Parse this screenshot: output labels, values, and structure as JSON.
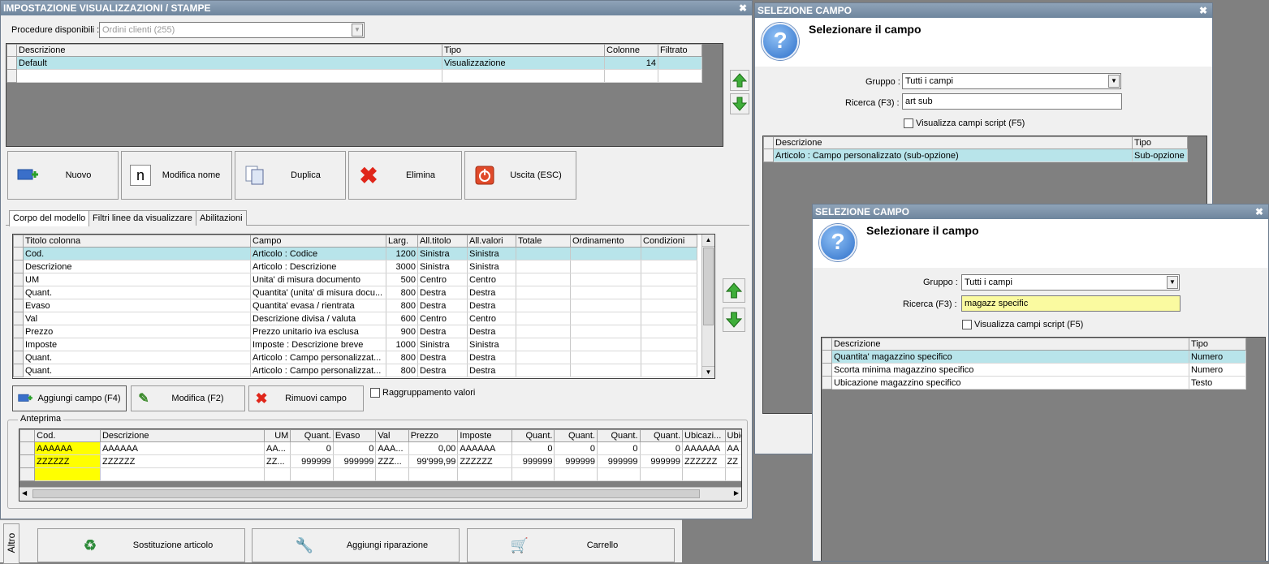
{
  "main_window": {
    "title": "IMPOSTAZIONE VISUALIZZAZIONI / STAMPE",
    "procedure_label": "Procedure disponibili :",
    "procedure_value": "Ordini clienti (255)",
    "models_table": {
      "headers": [
        "Descrizione",
        "Tipo",
        "Colonne",
        "Filtrato"
      ],
      "rows": [
        {
          "descrizione": "Default",
          "tipo": "Visualizzazione",
          "colonne": "14",
          "filtrato": ""
        }
      ]
    },
    "buttons": {
      "nuovo": "Nuovo",
      "modifica_nome": "Modifica nome",
      "duplica": "Duplica",
      "elimina": "Elimina",
      "uscita": "Uscita (ESC)"
    },
    "tabs": [
      "Corpo del modello",
      "Filtri linee da visualizzare",
      "Abilitazioni"
    ],
    "columns_table": {
      "headers": [
        "Titolo colonna",
        "Campo",
        "Larg.",
        "All.titolo",
        "All.valori",
        "Totale",
        "Ordinamento",
        "Condizioni"
      ],
      "rows": [
        [
          "Cod.",
          "Articolo : Codice",
          "1200",
          "Sinistra",
          "Sinistra",
          "",
          "",
          ""
        ],
        [
          "Descrizione",
          "Articolo : Descrizione",
          "3000",
          "Sinistra",
          "Sinistra",
          "",
          "",
          ""
        ],
        [
          "UM",
          "Unita' di misura documento",
          "500",
          "Centro",
          "Centro",
          "",
          "",
          ""
        ],
        [
          "Quant.",
          "Quantita' (unita' di misura docu...",
          "800",
          "Destra",
          "Destra",
          "",
          "",
          ""
        ],
        [
          "Evaso",
          "Quantita' evasa / rientrata",
          "800",
          "Destra",
          "Destra",
          "",
          "",
          ""
        ],
        [
          "Val",
          "Descrizione divisa / valuta",
          "600",
          "Centro",
          "Centro",
          "",
          "",
          ""
        ],
        [
          "Prezzo",
          "Prezzo unitario iva esclusa",
          "900",
          "Destra",
          "Destra",
          "",
          "",
          ""
        ],
        [
          "Imposte",
          "Imposte : Descrizione breve",
          "1000",
          "Sinistra",
          "Sinistra",
          "",
          "",
          ""
        ],
        [
          "Quant.",
          "Articolo : Campo personalizzat...",
          "800",
          "Destra",
          "Destra",
          "",
          "",
          ""
        ],
        [
          "Quant.",
          "Articolo : Campo personalizzat...",
          "800",
          "Destra",
          "Destra",
          "",
          "",
          ""
        ]
      ]
    },
    "field_buttons": {
      "aggiungi": "Aggiungi campo (F4)",
      "modifica": "Modifica (F2)",
      "rimuovi": "Rimuovi campo",
      "raggruppamento": "Raggruppamento valori"
    },
    "preview": {
      "label": "Anteprima",
      "headers": [
        "Cod.",
        "Descrizione",
        "UM",
        "Quant.",
        "Evaso",
        "Val",
        "Prezzo",
        "Imposte",
        "Quant.",
        "Quant.",
        "Quant.",
        "Quant.",
        "Ubicazi...",
        "Ubic"
      ],
      "rows": [
        [
          "AAAAAA",
          "AAAAAA",
          "AA...",
          "0",
          "0",
          "AAA...",
          "0,00",
          "AAAAAA",
          "0",
          "0",
          "0",
          "0",
          "AAAAAA",
          "AA"
        ],
        [
          "ZZZZZZ",
          "ZZZZZZ",
          "ZZ...",
          "999999",
          "999999",
          "ZZZ...",
          "99'999,99",
          "ZZZZZZ",
          "999999",
          "999999",
          "999999",
          "999999",
          "ZZZZZZ",
          "ZZ"
        ]
      ]
    }
  },
  "bottom_bar": {
    "side_label": "Altro",
    "buttons": [
      "Sostituzione articolo",
      "Aggiungi riparazione",
      "Carrello"
    ]
  },
  "dialog1": {
    "title": "SELEZIONE CAMPO",
    "heading": "Selezionare il campo",
    "gruppo_label": "Gruppo :",
    "gruppo_value": "Tutti i campi",
    "ricerca_label": "Ricerca (F3) :",
    "ricerca_value": "art sub",
    "script_label": "Visualizza campi script (F5)",
    "headers": [
      "Descrizione",
      "Tipo"
    ],
    "rows": [
      [
        "Articolo : Campo personalizzato (sub-opzione)",
        "Sub-opzione"
      ]
    ]
  },
  "dialog2": {
    "title": "SELEZIONE CAMPO",
    "heading": "Selezionare il campo",
    "gruppo_label": "Gruppo :",
    "gruppo_value": "Tutti i campi",
    "ricerca_label": "Ricerca (F3) :",
    "ricerca_value": "magazz specific",
    "script_label": "Visualizza campi script (F5)",
    "headers": [
      "Descrizione",
      "Tipo"
    ],
    "rows": [
      [
        "Quantita' magazzino specifico",
        "Numero"
      ],
      [
        "Scorta minima magazzino specifico",
        "Numero"
      ],
      [
        "Ubicazione magazzino specifico",
        "Testo"
      ]
    ]
  }
}
